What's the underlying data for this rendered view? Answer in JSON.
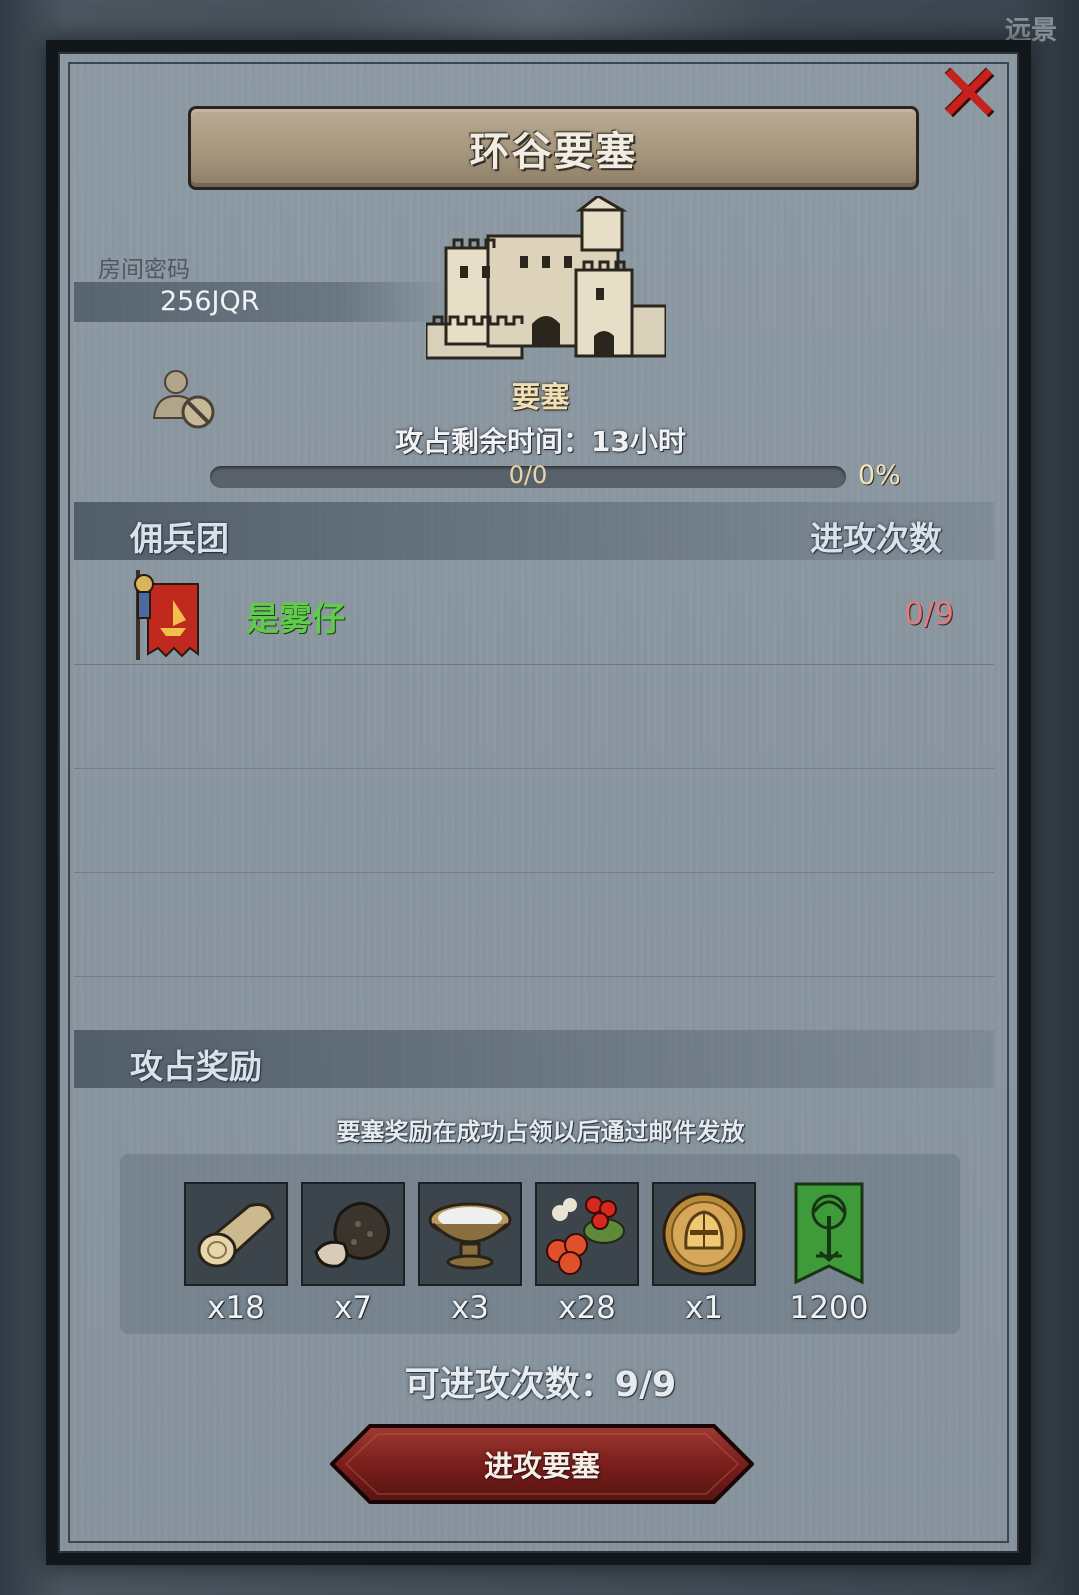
{
  "background": {
    "corner_text": "远景"
  },
  "dialog": {
    "title": "环谷要塞",
    "close_icon": "close-x-icon",
    "room": {
      "label": "房间密码",
      "code": "256JQR"
    },
    "fortress": {
      "name": "要塞",
      "time_label": "攻占剩余时间：",
      "time_value": "13小时",
      "progress_text": "0/0",
      "progress_fraction": 0,
      "progress_percent": "0%"
    },
    "mercenary": {
      "section_title": "佣兵团",
      "attacks_header": "进攻次数",
      "rows": [
        {
          "name": "是雾仔",
          "attacks": "0/9",
          "name_color": "#5fcc4a",
          "attacks_color": "#e07d7d"
        }
      ]
    },
    "rewards": {
      "section_title": "攻占奖励",
      "note": "要塞奖励在成功占领以后通过邮件发放",
      "items": [
        {
          "icon": "wood-log-icon",
          "qty": "x18"
        },
        {
          "icon": "truffle-icon",
          "qty": "x7"
        },
        {
          "icon": "milk-bowl-icon",
          "qty": "x3"
        },
        {
          "icon": "berries-icon",
          "qty": "x28"
        },
        {
          "icon": "knight-helmet-coin-icon",
          "qty": "x1"
        },
        {
          "icon": "tree-banner-icon",
          "qty": "1200"
        }
      ]
    },
    "attack_remaining": {
      "label": "可进攻次数：",
      "value": "9/9"
    },
    "attack_button": "进攻要塞"
  },
  "colors": {
    "accent_gold": "#f0dfb2",
    "guild_green": "#5fcc4a",
    "attacks_red": "#e07d7d",
    "button_red": "#7a1f1c"
  }
}
